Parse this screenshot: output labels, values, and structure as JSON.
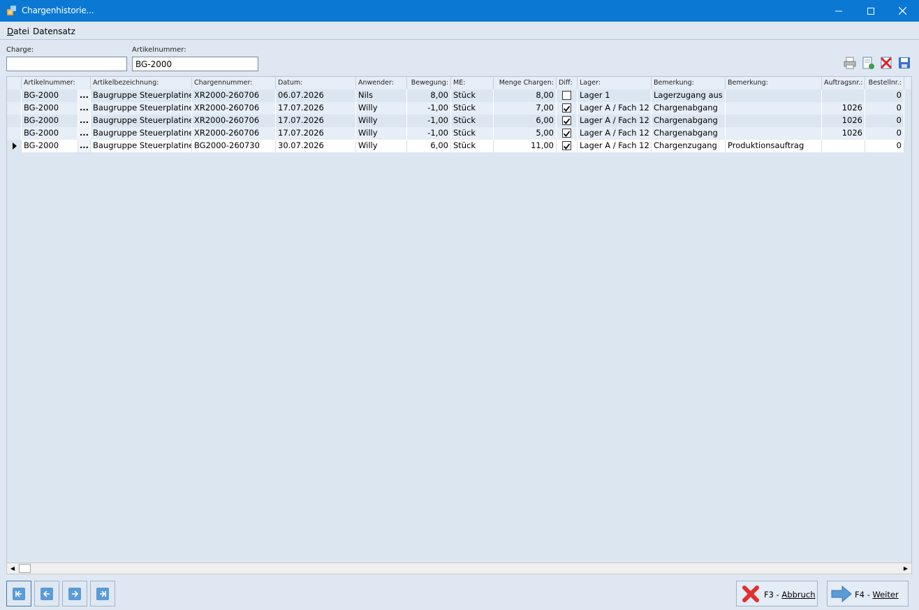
{
  "window": {
    "title": "Chargenhistorie..."
  },
  "menu": {
    "file": "Datei",
    "record": "Datensatz"
  },
  "filters": {
    "charge_label": "Charge:",
    "charge_value": "",
    "article_label": "Artikelnummer:",
    "article_value": "BG-2000"
  },
  "toolbar": {
    "icons": [
      "printer-icon",
      "export-icon",
      "delete-icon",
      "save-icon"
    ]
  },
  "table": {
    "columns": [
      "Artikelnummer:",
      "Artikelbezeichnung:",
      "Chargennummer:",
      "Datum:",
      "Anwender:",
      "Bewegung:",
      "ME:",
      "Menge Chargen:",
      "Diff:",
      "Lager:",
      "Bemerkung:",
      "Bemerkung:",
      "Auftragsnr.:",
      "Bestellnr.:"
    ],
    "ellipsis": "...",
    "rows": [
      {
        "artikel": "BG-2000",
        "bezeichnung": "Baugruppe Steuerplatine",
        "charge": "XR2000-260706",
        "datum": "06.07.2026",
        "anwender": "Nils",
        "bewegung": "8,00",
        "me": "Stück",
        "menge": "8,00",
        "diff": false,
        "lager": "Lager 1",
        "bem1": "Lagerzugang aus",
        "bem2": "",
        "auftrag": "",
        "bestell": "0"
      },
      {
        "artikel": "BG-2000",
        "bezeichnung": "Baugruppe Steuerplatine",
        "charge": "XR2000-260706",
        "datum": "17.07.2026",
        "anwender": "Willy",
        "bewegung": "-1,00",
        "me": "Stück",
        "menge": "7,00",
        "diff": true,
        "lager": "Lager A / Fach 12",
        "bem1": "Chargenabgang",
        "bem2": "",
        "auftrag": "1026",
        "bestell": "0"
      },
      {
        "artikel": "BG-2000",
        "bezeichnung": "Baugruppe Steuerplatine",
        "charge": "XR2000-260706",
        "datum": "17.07.2026",
        "anwender": "Willy",
        "bewegung": "-1,00",
        "me": "Stück",
        "menge": "6,00",
        "diff": true,
        "lager": "Lager A / Fach 12",
        "bem1": "Chargenabgang",
        "bem2": "",
        "auftrag": "1026",
        "bestell": "0"
      },
      {
        "artikel": "BG-2000",
        "bezeichnung": "Baugruppe Steuerplatine",
        "charge": "XR2000-260706",
        "datum": "17.07.2026",
        "anwender": "Willy",
        "bewegung": "-1,00",
        "me": "Stück",
        "menge": "5,00",
        "diff": true,
        "lager": "Lager A / Fach 12",
        "bem1": "Chargenabgang",
        "bem2": "",
        "auftrag": "1026",
        "bestell": "0"
      },
      {
        "artikel": "BG-2000",
        "bezeichnung": "Baugruppe Steuerplatine",
        "charge": "BG2000-260730",
        "datum": "30.07.2026",
        "anwender": "Willy",
        "bewegung": "6,00",
        "me": "Stück",
        "menge": "11,00",
        "diff": true,
        "lager": "Lager A / Fach 12",
        "bem1": "Chargenzugang",
        "bem2": "Produktionsauftrag",
        "auftrag": "",
        "bestell": "0"
      }
    ],
    "current_row": 4
  },
  "navigation": {
    "buttons": [
      "first-record",
      "previous-record",
      "next-record",
      "last-record"
    ]
  },
  "actions": {
    "cancel_key": "F3 - ",
    "cancel_label": "Abbruch",
    "next_key": "F4 - ",
    "next_label": "Weiter"
  },
  "colors": {
    "titlebar": "#0b78d4",
    "background": "#dfe8f2",
    "cancel": "#e03030",
    "next": "#5a9bd8"
  }
}
